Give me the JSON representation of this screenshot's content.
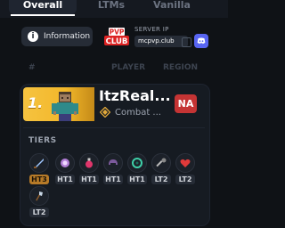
{
  "tabs": [
    {
      "label": "Overall",
      "active": true
    },
    {
      "label": "LTMs",
      "active": false
    },
    {
      "label": "Vanilla",
      "active": false
    }
  ],
  "info_button": {
    "label": "Information",
    "icon": "info-icon"
  },
  "logo": {
    "line1": "PVP",
    "line2": "CLUB"
  },
  "server": {
    "label": "SERVER IP",
    "address": "mcpvp.club",
    "copy_icon": "copy-icon",
    "discord_icon": "discord-icon"
  },
  "table_header": {
    "rank": "#",
    "player": "PLAYER",
    "region": "REGION"
  },
  "player": {
    "rank": "1.",
    "name": "ItzReal...",
    "title": "Combat ...",
    "title_icon": "combat-master-icon",
    "region": "NA"
  },
  "tiers_label": "TIERS",
  "tiers": [
    {
      "icon": "sword-icon",
      "label": "HT3",
      "highlight": true
    },
    {
      "icon": "orb-icon",
      "label": "HT1",
      "highlight": false
    },
    {
      "icon": "potion-icon",
      "label": "HT1",
      "highlight": false
    },
    {
      "icon": "netherite-helmet-icon",
      "label": "HT1",
      "highlight": false
    },
    {
      "icon": "crystal-icon",
      "label": "HT1",
      "highlight": false
    },
    {
      "icon": "mace-icon",
      "label": "LT2",
      "highlight": false
    },
    {
      "icon": "heart-icon",
      "label": "LT2",
      "highlight": false
    },
    {
      "icon": "axe-icon",
      "label": "LT2",
      "highlight": false
    }
  ],
  "colors": {
    "background": "#0f1216",
    "card": "#161b22",
    "gold": "#f6c340",
    "region": "#c53434",
    "discord": "#5865f2"
  }
}
